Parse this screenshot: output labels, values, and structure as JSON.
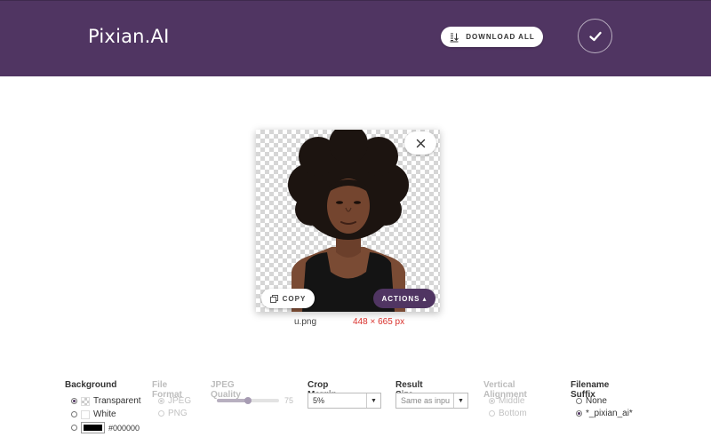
{
  "header": {
    "brand": "Pixian.AI",
    "download_all_label": "DOWNLOAD ALL",
    "download_icon": "download-icon",
    "confirm_icon": "checkmark-icon",
    "background_color": "#503562"
  },
  "image": {
    "copy_label": "COPY",
    "actions_label": "ACTIONS",
    "filename": "u.png",
    "dimensions": "448 × 665 px",
    "close_icon": "close-icon",
    "copy_icon": "copy-icon",
    "actions_icon": "caret-up-icon"
  },
  "settings": {
    "background": {
      "title": "Background",
      "options": [
        {
          "label": "Transparent",
          "selected": true
        },
        {
          "label": "White",
          "selected": false
        },
        {
          "label": "#000000",
          "selected": false,
          "color": "#000000"
        }
      ]
    },
    "file_format": {
      "title": "File Format",
      "disabled": true,
      "options": [
        {
          "label": "JPEG",
          "selected": true
        },
        {
          "label": "PNG",
          "selected": false
        }
      ]
    },
    "jpeg_quality": {
      "title": "JPEG Quality",
      "disabled": true,
      "value": "75",
      "fraction": 0.5
    },
    "crop_margin": {
      "title": "Crop Margin",
      "value": "5%"
    },
    "result_size": {
      "title": "Result Size",
      "value": "Same as inpu"
    },
    "vertical_alignment": {
      "title": "Vertical Alignment",
      "disabled": true,
      "options": [
        {
          "label": "Middle",
          "selected": true
        },
        {
          "label": "Bottom",
          "selected": false
        }
      ]
    },
    "filename_suffix": {
      "title": "Filename Suffix",
      "options": [
        {
          "label": "None",
          "selected": false
        },
        {
          "label": "*_pixian_ai*",
          "selected": true
        }
      ]
    }
  },
  "colors": {
    "accent": "#503562",
    "error_text": "#d9302b"
  }
}
